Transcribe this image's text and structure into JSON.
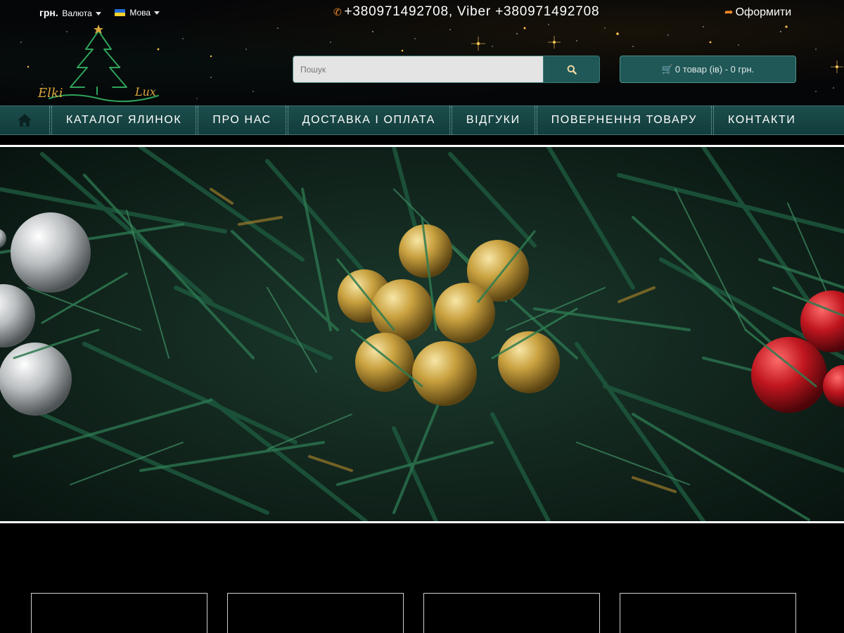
{
  "topbar": {
    "currency_symbol": "грн.",
    "currency_label": "Валюта",
    "language_label": "Мова",
    "phone": "+380971492708, Viber +380971492708",
    "checkout_label": "Оформити"
  },
  "logo": {
    "text_left": "Elki",
    "text_right": "Lux"
  },
  "search": {
    "placeholder": "Пошук"
  },
  "cart": {
    "label": "0 товар (ів) - 0 грн."
  },
  "nav": {
    "items": [
      {
        "label": "Каталог ялинок"
      },
      {
        "label": "Про нас"
      },
      {
        "label": "Доставка і оплата"
      },
      {
        "label": "Відгуки"
      },
      {
        "label": "Повернення товару"
      },
      {
        "label": "Контакти"
      }
    ]
  },
  "icons": {
    "phone": "phone-icon",
    "checkout": "share-arrow-icon",
    "search": "search-icon",
    "cart": "cart-icon",
    "home": "home-icon"
  },
  "colors": {
    "accent_orange": "#f28c28",
    "nav_teal": "#1c4d4c",
    "button_teal": "#1f5857"
  }
}
